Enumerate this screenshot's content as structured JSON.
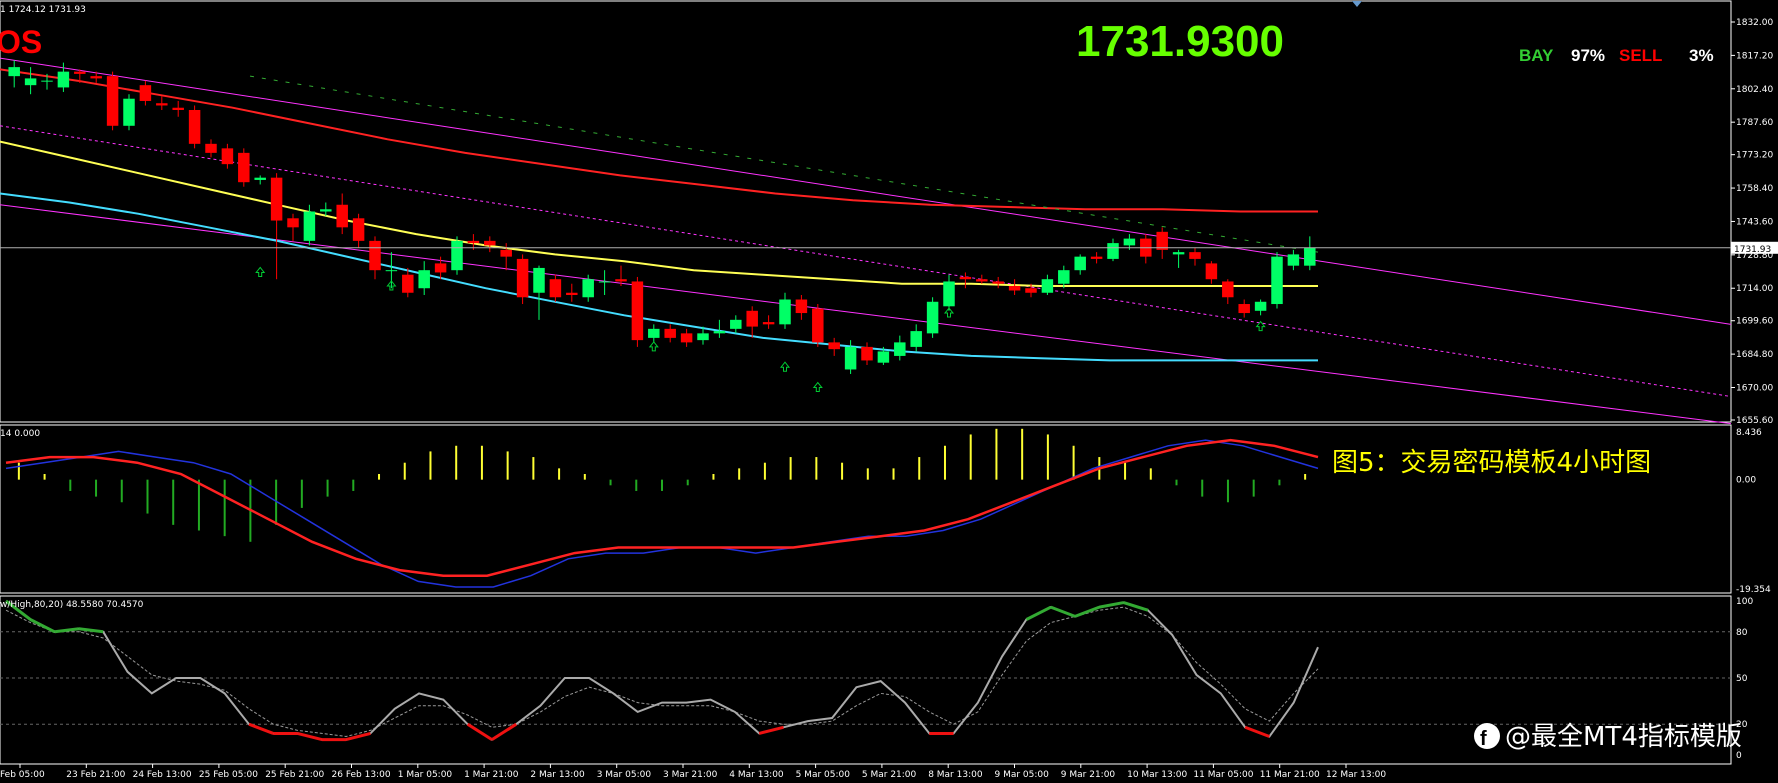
{
  "header": {
    "info_line": "1 1724.12 1731.93",
    "symbol_fragment": "OS",
    "big_price": "1731.9300",
    "bay_label": "BAY",
    "bay_pct": "97%",
    "sell_label": "SELL",
    "sell_pct": "3%"
  },
  "colors": {
    "bull": "#00ff66",
    "bear": "#ff0000",
    "upper_channel": "#ff33ff",
    "ma_red": "#ff2222",
    "ma_yellow": "#ffff55",
    "ma_cyan": "#44ddff",
    "big_price": "#66ff00",
    "caption": "#ffff00",
    "signal_arrow": "#00cc33"
  },
  "caption": "图5：交易密码模板4小时图",
  "watermark": "@最全MT4指标模版",
  "main_panel": {
    "price_labels": [
      "1832.00",
      "1817.20",
      "1802.40",
      "1787.60",
      "1773.20",
      "1758.40",
      "1743.60",
      "1728.80",
      "1714.00",
      "1699.60",
      "1684.80",
      "1670.00",
      "1655.60"
    ],
    "current_price_label": "1731.93",
    "current_price": 1731.93
  },
  "macd_panel": {
    "info": "14 0.000",
    "labels": [
      "8.436",
      "0.00",
      "-19.354"
    ]
  },
  "stoch_panel": {
    "info": "w/High,80,20) 48.5580 70.4570",
    "labels": [
      "100",
      "80",
      "50",
      "20",
      "0"
    ],
    "levels": [
      100,
      80,
      50,
      20,
      0
    ]
  },
  "time_labels": [
    "Feb 05:00",
    "23 Feb 21:00",
    "24 Feb 13:00",
    "25 Feb 05:00",
    "25 Feb 21:00",
    "26 Feb 13:00",
    "1 Mar 05:00",
    "1 Mar 21:00",
    "2 Mar 13:00",
    "3 Mar 05:00",
    "3 Mar 21:00",
    "4 Mar 13:00",
    "5 Mar 05:00",
    "5 Mar 21:00",
    "8 Mar 13:00",
    "9 Mar 05:00",
    "9 Mar 21:00",
    "10 Mar 13:00",
    "11 Mar 05:00",
    "11 Mar 21:00",
    "12 Mar 13:00"
  ],
  "chart_data": {
    "type": "candlestick",
    "x_categories": [
      "Feb 05:00",
      "23 Feb 21:00",
      "24 Feb 13:00",
      "25 Feb 05:00",
      "25 Feb 21:00",
      "26 Feb 13:00",
      "1 Mar 05:00",
      "1 Mar 21:00",
      "2 Mar 13:00",
      "3 Mar 05:00",
      "3 Mar 21:00",
      "4 Mar 13:00",
      "5 Mar 05:00",
      "5 Mar 21:00",
      "8 Mar 13:00",
      "9 Mar 05:00",
      "9 Mar 21:00",
      "10 Mar 13:00",
      "11 Mar 05:00",
      "11 Mar 21:00",
      "12 Mar 13:00"
    ],
    "ylim": [
      1655.6,
      1832.0
    ],
    "candles": [
      {
        "o": 1808,
        "c": 1812,
        "h": 1815,
        "l": 1803
      },
      {
        "o": 1804,
        "c": 1807,
        "h": 1812,
        "l": 1800
      },
      {
        "o": 1806,
        "c": 1806,
        "h": 1809,
        "l": 1802
      },
      {
        "o": 1803,
        "c": 1810,
        "h": 1814,
        "l": 1801
      },
      {
        "o": 1810,
        "c": 1809,
        "h": 1811,
        "l": 1805
      },
      {
        "o": 1808,
        "c": 1807,
        "h": 1810,
        "l": 1805
      },
      {
        "o": 1808,
        "c": 1786,
        "h": 1810,
        "l": 1784
      },
      {
        "o": 1786,
        "c": 1798,
        "h": 1800,
        "l": 1784
      },
      {
        "o": 1804,
        "c": 1797,
        "h": 1806,
        "l": 1795
      },
      {
        "o": 1796,
        "c": 1795,
        "h": 1799,
        "l": 1793
      },
      {
        "o": 1794,
        "c": 1793,
        "h": 1797,
        "l": 1790
      },
      {
        "o": 1793,
        "c": 1778,
        "h": 1795,
        "l": 1776
      },
      {
        "o": 1778,
        "c": 1774,
        "h": 1780,
        "l": 1772
      },
      {
        "o": 1776,
        "c": 1769,
        "h": 1778,
        "l": 1767
      },
      {
        "o": 1774,
        "c": 1761,
        "h": 1776,
        "l": 1759
      },
      {
        "o": 1762,
        "c": 1763,
        "h": 1764,
        "l": 1760
      },
      {
        "o": 1763,
        "c": 1744,
        "h": 1765,
        "l": 1718
      },
      {
        "o": 1745,
        "c": 1741,
        "h": 1747,
        "l": 1735
      },
      {
        "o": 1735,
        "c": 1748,
        "h": 1751,
        "l": 1733
      },
      {
        "o": 1748,
        "c": 1749,
        "h": 1752,
        "l": 1746
      },
      {
        "o": 1751,
        "c": 1741,
        "h": 1756,
        "l": 1738
      },
      {
        "o": 1745,
        "c": 1735,
        "h": 1747,
        "l": 1732
      },
      {
        "o": 1735,
        "c": 1722,
        "h": 1737,
        "l": 1718
      },
      {
        "o": 1722,
        "c": 1722,
        "h": 1730,
        "l": 1714
      },
      {
        "o": 1720,
        "c": 1712,
        "h": 1723,
        "l": 1710
      },
      {
        "o": 1714,
        "c": 1722,
        "h": 1726,
        "l": 1711
      },
      {
        "o": 1725,
        "c": 1721,
        "h": 1728,
        "l": 1718
      },
      {
        "o": 1722,
        "c": 1735,
        "h": 1737,
        "l": 1720
      },
      {
        "o": 1735,
        "c": 1734,
        "h": 1738,
        "l": 1731
      },
      {
        "o": 1735,
        "c": 1733,
        "h": 1737,
        "l": 1730
      },
      {
        "o": 1731,
        "c": 1728,
        "h": 1734,
        "l": 1722
      },
      {
        "o": 1727,
        "c": 1710,
        "h": 1729,
        "l": 1707
      },
      {
        "o": 1712,
        "c": 1723,
        "h": 1724,
        "l": 1700
      },
      {
        "o": 1718,
        "c": 1710,
        "h": 1720,
        "l": 1708
      },
      {
        "o": 1712,
        "c": 1711,
        "h": 1716,
        "l": 1708
      },
      {
        "o": 1710,
        "c": 1718,
        "h": 1720,
        "l": 1708
      },
      {
        "o": 1717,
        "c": 1717,
        "h": 1722,
        "l": 1711
      },
      {
        "o": 1718,
        "c": 1717,
        "h": 1724,
        "l": 1715
      },
      {
        "o": 1717,
        "c": 1691,
        "h": 1719,
        "l": 1688
      },
      {
        "o": 1692,
        "c": 1696,
        "h": 1698,
        "l": 1690
      },
      {
        "o": 1696,
        "c": 1692,
        "h": 1698,
        "l": 1690
      },
      {
        "o": 1694,
        "c": 1690,
        "h": 1696,
        "l": 1688
      },
      {
        "o": 1691,
        "c": 1694,
        "h": 1697,
        "l": 1689
      },
      {
        "o": 1694,
        "c": 1695,
        "h": 1700,
        "l": 1692
      },
      {
        "o": 1696,
        "c": 1700,
        "h": 1702,
        "l": 1694
      },
      {
        "o": 1704,
        "c": 1697,
        "h": 1706,
        "l": 1692
      },
      {
        "o": 1699,
        "c": 1698,
        "h": 1702,
        "l": 1696
      },
      {
        "o": 1698,
        "c": 1709,
        "h": 1712,
        "l": 1696
      },
      {
        "o": 1709,
        "c": 1703,
        "h": 1711,
        "l": 1700
      },
      {
        "o": 1705,
        "c": 1690,
        "h": 1707,
        "l": 1688
      },
      {
        "o": 1690,
        "c": 1687,
        "h": 1692,
        "l": 1684
      },
      {
        "o": 1678,
        "c": 1688,
        "h": 1691,
        "l": 1676
      },
      {
        "o": 1688,
        "c": 1682,
        "h": 1690,
        "l": 1680
      },
      {
        "o": 1681,
        "c": 1686,
        "h": 1688,
        "l": 1680
      },
      {
        "o": 1684,
        "c": 1690,
        "h": 1693,
        "l": 1682
      },
      {
        "o": 1688,
        "c": 1695,
        "h": 1698,
        "l": 1686
      },
      {
        "o": 1694,
        "c": 1708,
        "h": 1710,
        "l": 1692
      },
      {
        "o": 1706,
        "c": 1717,
        "h": 1720,
        "l": 1704
      },
      {
        "o": 1719,
        "c": 1718,
        "h": 1721,
        "l": 1714
      },
      {
        "o": 1718,
        "c": 1717,
        "h": 1720,
        "l": 1716
      },
      {
        "o": 1717,
        "c": 1716,
        "h": 1719,
        "l": 1714
      },
      {
        "o": 1715,
        "c": 1713,
        "h": 1718,
        "l": 1711
      },
      {
        "o": 1714,
        "c": 1712,
        "h": 1716,
        "l": 1710
      },
      {
        "o": 1712,
        "c": 1718,
        "h": 1720,
        "l": 1711
      },
      {
        "o": 1716,
        "c": 1722,
        "h": 1724,
        "l": 1714
      },
      {
        "o": 1722,
        "c": 1728,
        "h": 1729,
        "l": 1720
      },
      {
        "o": 1728,
        "c": 1727,
        "h": 1730,
        "l": 1725
      },
      {
        "o": 1727,
        "c": 1734,
        "h": 1736,
        "l": 1726
      },
      {
        "o": 1733,
        "c": 1736,
        "h": 1738,
        "l": 1731
      },
      {
        "o": 1736,
        "c": 1728,
        "h": 1738,
        "l": 1725
      },
      {
        "o": 1739,
        "c": 1731,
        "h": 1741,
        "l": 1727
      },
      {
        "o": 1729,
        "c": 1730,
        "h": 1731,
        "l": 1723
      },
      {
        "o": 1730,
        "c": 1727,
        "h": 1732,
        "l": 1724
      },
      {
        "o": 1725,
        "c": 1718,
        "h": 1726,
        "l": 1716
      },
      {
        "o": 1717,
        "c": 1710,
        "h": 1718,
        "l": 1707
      },
      {
        "o": 1707,
        "c": 1703,
        "h": 1709,
        "l": 1701
      },
      {
        "o": 1704,
        "c": 1708,
        "h": 1709,
        "l": 1702
      },
      {
        "o": 1707,
        "c": 1728,
        "h": 1730,
        "l": 1705
      },
      {
        "o": 1724,
        "c": 1729,
        "h": 1731,
        "l": 1722
      },
      {
        "o": 1724,
        "c": 1732,
        "h": 1737,
        "l": 1722
      }
    ],
    "overlays": [
      {
        "name": "upper_channel",
        "color": "#ff33ff",
        "points": [
          [
            1816
          ],
          [
            1698
          ]
        ]
      },
      {
        "name": "lower_channel",
        "color": "#ff33ff",
        "points": [
          [
            1751
          ],
          [
            1654
          ]
        ]
      },
      {
        "name": "ma_red",
        "color": "#ff2222",
        "values": [
          1811,
          1806,
          1800,
          1794,
          1787,
          1780,
          1774,
          1769,
          1764,
          1760,
          1756,
          1753,
          1751,
          1750,
          1749,
          1749,
          1748,
          1748
        ]
      },
      {
        "name": "ma_yellow",
        "color": "#ffff55",
        "values": [
          1779,
          1772,
          1765,
          1758,
          1751,
          1744,
          1738,
          1733,
          1729,
          1726,
          1722,
          1720,
          1718,
          1716,
          1716,
          1715,
          1715,
          1715,
          1715,
          1715
        ]
      },
      {
        "name": "ma_cyan",
        "color": "#44ddff",
        "values": [
          1756,
          1752,
          1747,
          1741,
          1735,
          1728,
          1721,
          1714,
          1708,
          1702,
          1697,
          1692,
          1689,
          1686,
          1684,
          1683,
          1682,
          1682,
          1682,
          1682
        ]
      }
    ],
    "macd": {
      "ylim": [
        -19.354,
        8.436
      ],
      "histogram": [
        3,
        1,
        -2,
        -3,
        -4,
        -6,
        -8,
        -9,
        -10,
        -11,
        -8,
        -5,
        -3,
        -2,
        1,
        3,
        5,
        6,
        6,
        5,
        4,
        2,
        1,
        -1,
        -2,
        -2,
        -1,
        1,
        2,
        3,
        4,
        4,
        3,
        2,
        2,
        4,
        6,
        8,
        9,
        9,
        8,
        6,
        4,
        3,
        2,
        -1,
        -3,
        -4,
        -3,
        -1,
        1
      ],
      "blue_line": [
        2,
        3,
        4,
        5,
        4,
        3,
        1,
        -3,
        -7,
        -11,
        -15,
        -18,
        -19,
        -19,
        -17,
        -14,
        -13,
        -13,
        -12,
        -12,
        -13,
        -12,
        -11,
        -10,
        -10,
        -9,
        -7,
        -4,
        -1,
        2,
        4,
        6,
        7,
        6,
        4,
        2
      ],
      "red_line": [
        3,
        4,
        4,
        3,
        1,
        -3,
        -7,
        -11,
        -14,
        -16,
        -17,
        -17,
        -15,
        -13,
        -12,
        -12,
        -12,
        -12,
        -12,
        -11,
        -10,
        -9,
        -7,
        -4,
        -1,
        2,
        4,
        6,
        7,
        6,
        4
      ]
    },
    "stochastic": {
      "ylim": [
        0,
        100
      ],
      "levels": [
        80,
        50,
        20
      ],
      "k_line": [
        100,
        88,
        80,
        82,
        80,
        54,
        40,
        50,
        50,
        40,
        20,
        14,
        14,
        10,
        10,
        14,
        30,
        40,
        36,
        20,
        10,
        20,
        32,
        50,
        50,
        40,
        28,
        34,
        34,
        36,
        28,
        14,
        18,
        22,
        24,
        44,
        48,
        34,
        14,
        14,
        34,
        64,
        88,
        96,
        90,
        96,
        99,
        94,
        78,
        52,
        40,
        18,
        12,
        34,
        70
      ],
      "d_line": [
        94,
        86,
        80,
        80,
        76,
        64,
        52,
        48,
        46,
        42,
        30,
        20,
        16,
        14,
        12,
        16,
        24,
        32,
        32,
        26,
        18,
        20,
        28,
        38,
        44,
        40,
        34,
        32,
        32,
        32,
        28,
        22,
        20,
        20,
        22,
        32,
        40,
        38,
        28,
        20,
        28,
        52,
        74,
        86,
        90,
        94,
        96,
        90,
        78,
        60,
        46,
        30,
        22,
        40,
        56
      ]
    }
  }
}
